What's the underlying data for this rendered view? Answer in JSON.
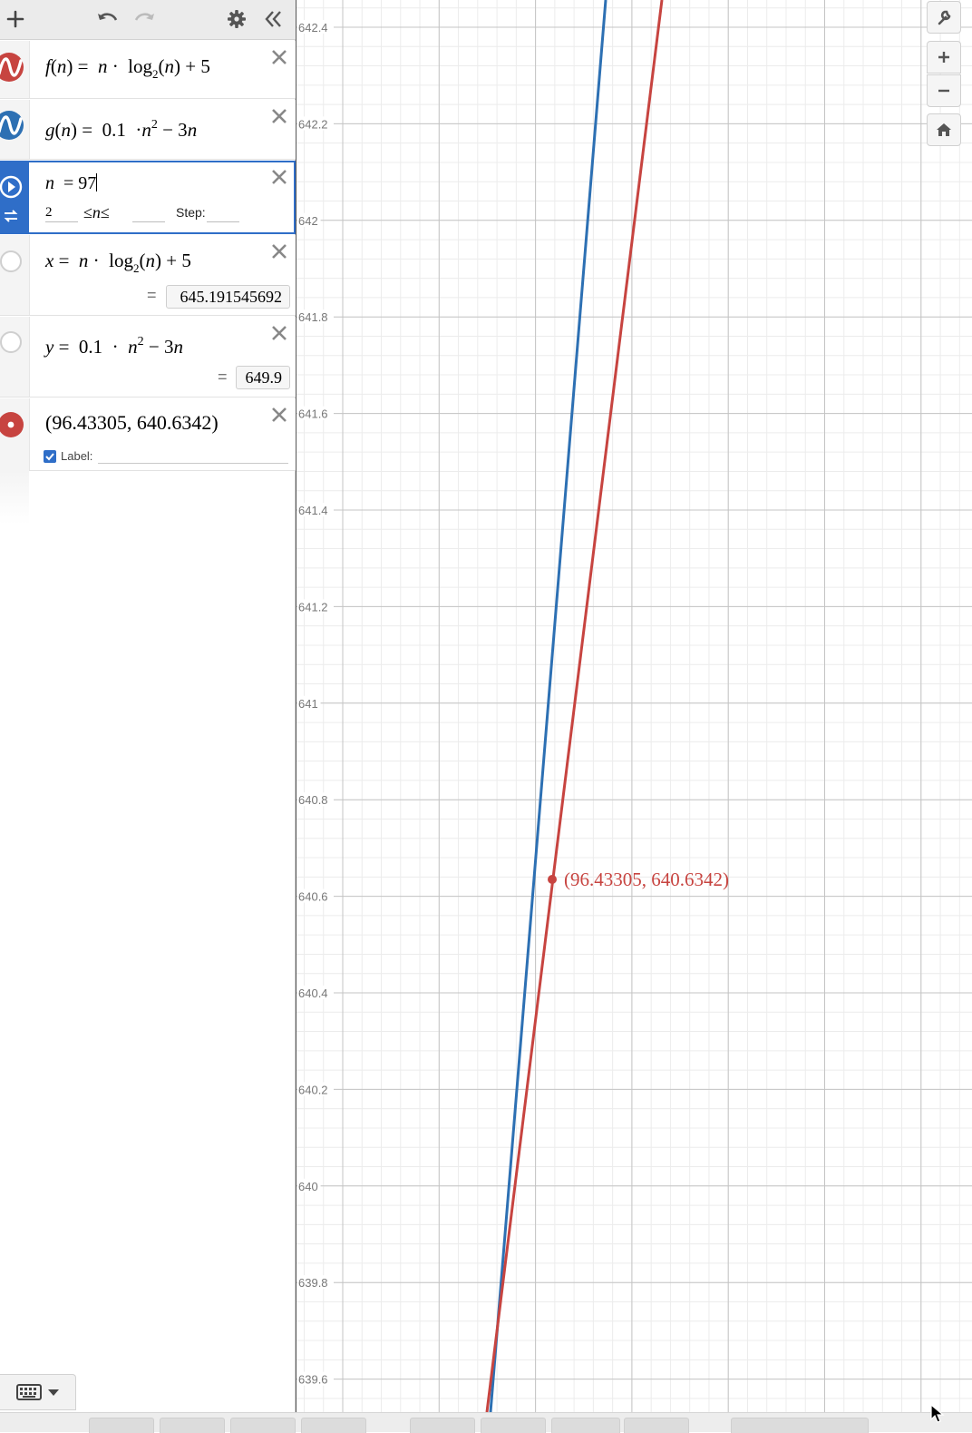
{
  "toolbar": {
    "add_icon": "plus-icon",
    "undo_icon": "undo-icon",
    "redo_icon": "redo-icon",
    "settings_icon": "gear-icon",
    "collapse_icon": "double-chevron-left-icon"
  },
  "expressions": [
    {
      "id": "f",
      "color": "#c74440",
      "icon": "wave-icon",
      "left": "f(n) =",
      "rhs": "n · log2(n) + 5"
    },
    {
      "id": "g",
      "color": "#2d70b3",
      "icon": "wave-icon",
      "left": "g(n) =",
      "rhs": "0.1 · n2 − 3n"
    },
    {
      "id": "n",
      "color": "#2f6ec8",
      "icon": "play-icon",
      "value_text": "n = 97",
      "slider": {
        "min": "2",
        "max": "",
        "step_label": "Step:",
        "step": ""
      }
    },
    {
      "id": "x",
      "formula": "x = n · log2(n) + 5",
      "result": "645.191545692"
    },
    {
      "id": "y",
      "formula": "y = 0.1 · n2 − 3n",
      "result": "649.9"
    },
    {
      "id": "point",
      "color": "#c74440",
      "formula": "(96.43305, 640.6342)",
      "label_toggle": "Label:",
      "label_checked": true
    }
  ],
  "graph": {
    "y_ticks": [
      "642.4",
      "642.2",
      "642",
      "641.8",
      "641.6",
      "641.4",
      "641.2",
      "641",
      "640.8",
      "640.6",
      "640.4",
      "640.2",
      "640",
      "639.8",
      "639.6"
    ],
    "point_label": "(96.43305, 640.6342)",
    "curve_colors": {
      "f": "#c74440",
      "g": "#2d70b3"
    }
  },
  "zoom": {
    "wrench_icon": "wrench-icon",
    "zoom_in_icon": "plus-icon",
    "zoom_out_icon": "minus-icon",
    "home_icon": "home-icon"
  }
}
